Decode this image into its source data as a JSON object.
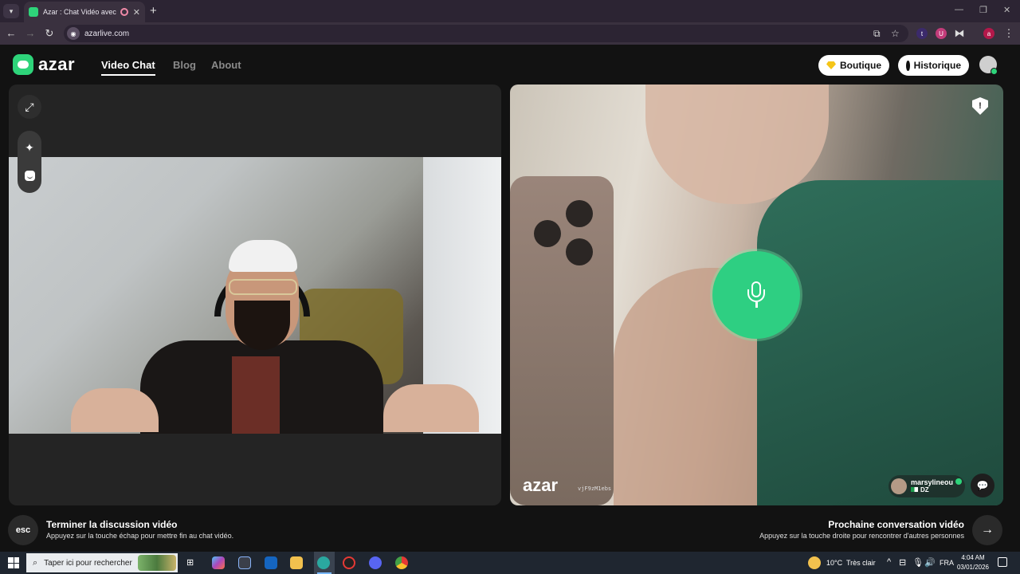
{
  "browser": {
    "tab_title": "Azar : Chat Vidéo avec de n",
    "url": "azarlive.com"
  },
  "header": {
    "logo_text": "azar",
    "nav": {
      "video_chat": "Video Chat",
      "blog": "Blog",
      "about": "About"
    },
    "boutique_label": "Boutique",
    "historique_label": "Historique"
  },
  "remote": {
    "watermark_logo": "azar",
    "watermark_id": "vjF9zM1ebs",
    "peer_name": "marsylineou",
    "peer_country": "DZ"
  },
  "footer": {
    "esc_label": "esc",
    "end_title": "Terminer la discussion vidéo",
    "end_sub": "Appuyez sur la touche échap pour mettre fin au chat vidéo.",
    "next_title": "Prochaine conversation vidéo",
    "next_sub": "Appuyez sur la touche droite pour rencontrer d'autres personnes"
  },
  "taskbar": {
    "search_placeholder": "Taper ici pour rechercher",
    "weather_temp": "10°C",
    "weather_desc": "Très clair",
    "lang": "FRA",
    "time": "4:04 AM",
    "date": "03/01/2026"
  },
  "colors": {
    "accent_green": "#2ed47a",
    "page_bg": "#121212",
    "panel_bg": "#242424"
  }
}
